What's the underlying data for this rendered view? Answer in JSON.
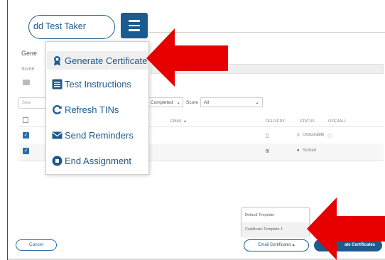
{
  "header": {
    "add_test_taker_label": "dd Test Taker"
  },
  "menu": {
    "items": [
      {
        "label": "Generate Certificate",
        "icon": "certificate-icon"
      },
      {
        "label": "Test Instructions",
        "icon": "list-icon"
      },
      {
        "label": "Refresh TINs",
        "icon": "refresh-icon"
      },
      {
        "label": "Send Reminders",
        "icon": "envelope-icon"
      },
      {
        "label": "End Assignment",
        "icon": "stop-circle-icon"
      }
    ]
  },
  "background": {
    "title": "Gene",
    "score_label": "Score",
    "search_placeholder": "Sear",
    "filter_completed": "Completed",
    "filter_score_label": "Score",
    "filter_all": "All",
    "columns": {
      "email": "EMAIL ▲",
      "delivery": "DELIVERY",
      "status": "STATUS",
      "overall": "OVERALL"
    },
    "rows": [
      {
        "status": "Unscorable"
      },
      {
        "status": "Scored"
      }
    ]
  },
  "template_menu": {
    "items": [
      "Default Template",
      "Certificate Template 1"
    ]
  },
  "footer": {
    "cancel_label": "Cancel",
    "email_certificates_label": "Email Certificates",
    "generate_certificates_label": "ate Certificates"
  },
  "colors": {
    "primary": "#1d5a8e",
    "arrow": "#e60000"
  }
}
